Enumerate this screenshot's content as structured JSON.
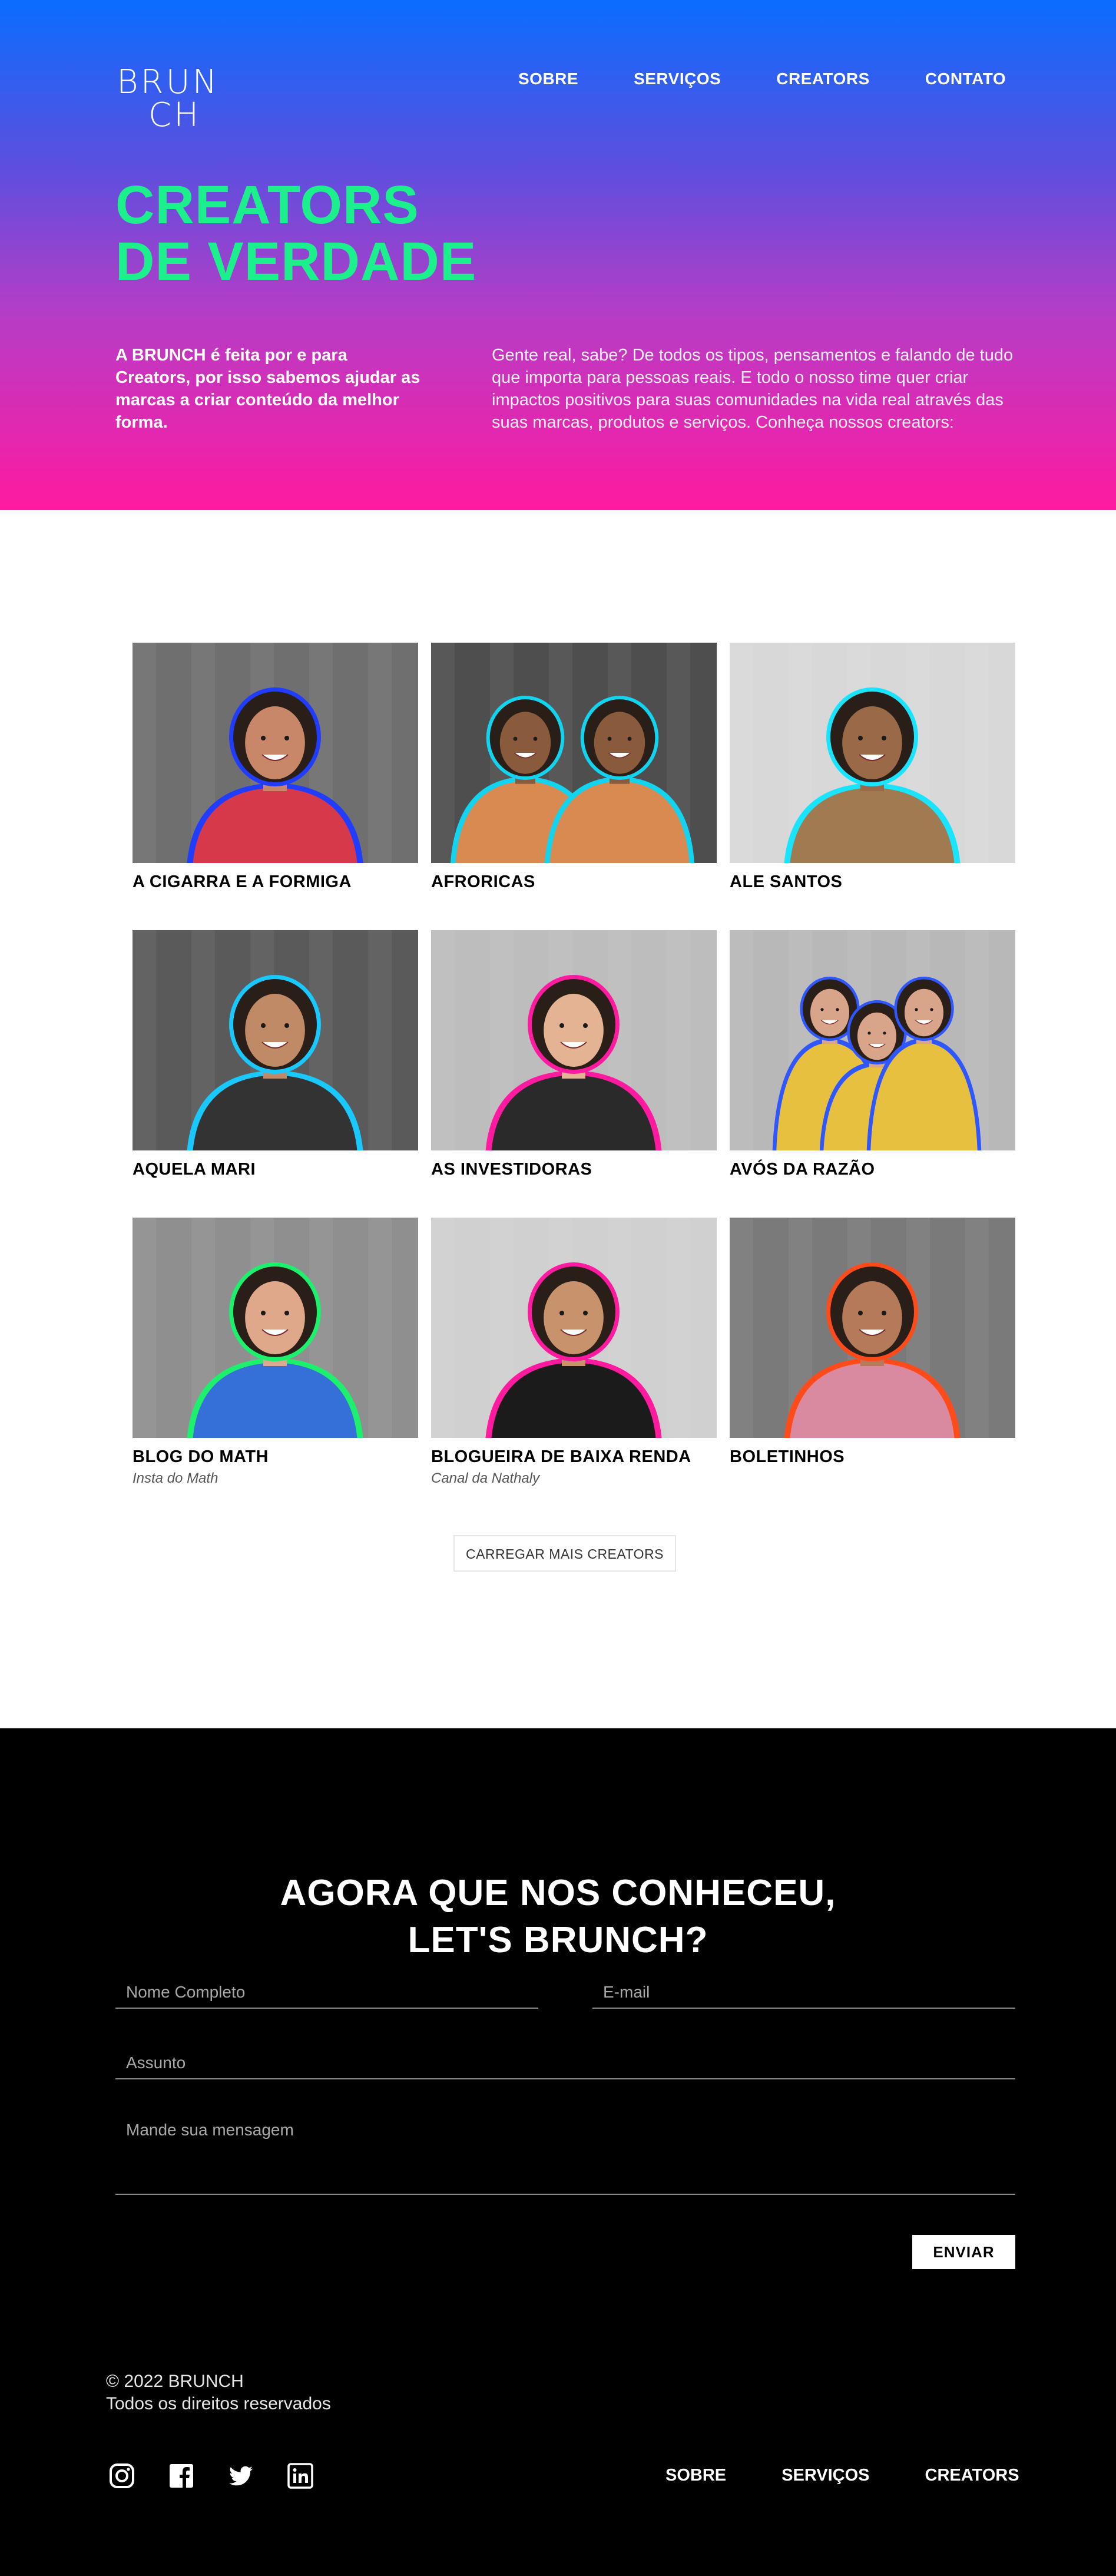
{
  "logo": {
    "line1": "BRUN",
    "line2": "CH"
  },
  "nav": {
    "items": [
      {
        "label": "SOBRE"
      },
      {
        "label": "SERVIÇOS"
      },
      {
        "label": "CREATORS"
      },
      {
        "label": "CONTATO"
      }
    ]
  },
  "hero": {
    "title_line1": "CREATORS",
    "title_line2": "DE VERDADE",
    "intro": "A BRUNCH é feita por e para Creators, por isso sabemos ajudar as marcas a criar conteúdo da melhor forma.",
    "description": "Gente real, sabe? De todos os tipos, pensamentos e falando de tudo que importa para pessoas reais. E todo o nosso time quer criar impactos positivos para suas comunidades na vida real através das suas marcas, produtos e serviços. Conheça nossos creators:"
  },
  "creators": {
    "items": [
      {
        "name": "A CIGARRA E A FORMIGA",
        "subtitle": "",
        "outline": "#1f3cff"
      },
      {
        "name": "AFRORICAS",
        "subtitle": "",
        "outline": "#12d4f0"
      },
      {
        "name": "ALE SANTOS",
        "subtitle": "",
        "outline": "#19e4ff"
      },
      {
        "name": "AQUELA MARI",
        "subtitle": "",
        "outline": "#18c8ff"
      },
      {
        "name": "AS INVESTIDORAS",
        "subtitle": "",
        "outline": "#ff1aa0"
      },
      {
        "name": "AVÓS DA RAZÃO",
        "subtitle": "",
        "outline": "#2f57ff"
      },
      {
        "name": "BLOG DO MATH",
        "subtitle": "Insta do Math",
        "outline": "#1cf06c"
      },
      {
        "name": "BLOGUEIRA DE BAIXA RENDA",
        "subtitle": "Canal da Nathaly",
        "outline": "#ff1aa0"
      },
      {
        "name": "BOLETINHOS",
        "subtitle": "",
        "outline": "#ff4a1a"
      }
    ],
    "load_more_label": "CARREGAR MAIS CREATORS"
  },
  "contact": {
    "title_line1": "AGORA QUE NOS CONHECEU,",
    "title_line2": "LET'S BRUNCH?",
    "name_placeholder": "Nome Completo",
    "email_placeholder": "E-mail",
    "subject_placeholder": "Assunto",
    "message_placeholder": "Mande sua mensagem",
    "send_label": "ENVIAR"
  },
  "footer": {
    "copyright_line1": "© 2022 BRUNCH",
    "copyright_line2": "Todos os direitos reservados",
    "socials": [
      "instagram-icon",
      "facebook-icon",
      "twitter-icon",
      "linkedin-icon"
    ],
    "nav": [
      {
        "label": "SOBRE"
      },
      {
        "label": "SERVIÇOS"
      },
      {
        "label": "CREATORS"
      }
    ]
  },
  "colors": {
    "hero_gradient_top": "#0a6dff",
    "hero_gradient_bottom": "#ff1aa0",
    "accent_green": "#1cf08c",
    "footer_bg": "#000000"
  }
}
